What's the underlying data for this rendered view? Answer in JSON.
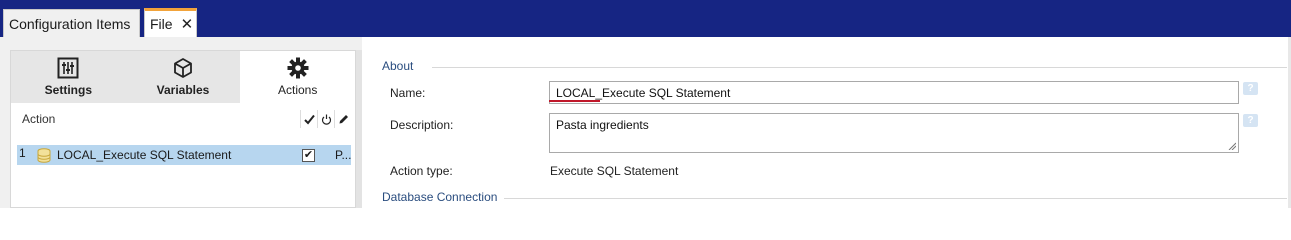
{
  "colors": {
    "topbar": "#162583",
    "accent_tab": "#f2a33a",
    "selected_row": "#b7d6ef",
    "section_title": "#2a4d7f",
    "error_underline": "#c0182a"
  },
  "top_tabs": [
    {
      "label": "Configuration Items"
    },
    {
      "label": "File",
      "close_icon": "close-icon"
    }
  ],
  "panel_tabs": [
    {
      "label": "Settings",
      "icon": "sliders-icon"
    },
    {
      "label": "Variables",
      "icon": "cube-icon"
    },
    {
      "label": "Actions",
      "icon": "gear-icon",
      "active": true
    }
  ],
  "actions_grid": {
    "header": {
      "action": "Action",
      "enabled_icon": "checkmark-icon",
      "run_icon": "power-icon",
      "edit_icon": "pencil-icon"
    },
    "rows": [
      {
        "index": "1",
        "icon": "database-icon",
        "name": "LOCAL_Execute SQL Statement",
        "enabled": true,
        "suffix": "P..."
      }
    ]
  },
  "about": {
    "section_title": "About",
    "name_label": "Name:",
    "name_value": "LOCAL_Execute SQL Statement",
    "description_label": "Description:",
    "description_value": "Pasta ingredients",
    "action_type_label": "Action type:",
    "action_type_value": "Execute SQL Statement",
    "help_icon": "help-icon"
  },
  "database": {
    "section_title": "Database Connection"
  }
}
